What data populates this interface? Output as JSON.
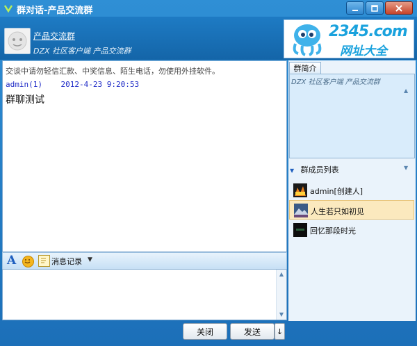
{
  "window": {
    "title": "群对话-产品交流群"
  },
  "header": {
    "group_name": "产品交流群",
    "group_subtitle": "DZX 社区客户端 产品交流群",
    "ad": {
      "top": "2345.com",
      "bottom": "网址大全"
    }
  },
  "chat": {
    "notice": "交谈中请勿轻信汇款、中奖信息、陌生电话，勿使用外挂软件。",
    "messages": [
      {
        "sender": "admin(1)",
        "time": "2012-4-23 9:20:53",
        "text": "群聊测试"
      }
    ]
  },
  "toolbar": {
    "history_label": "消息记录"
  },
  "input": {
    "value": "",
    "placeholder": ""
  },
  "buttons": {
    "close_label": "关闭",
    "send_label": "发送"
  },
  "sidebar": {
    "intro_tab": "群简介",
    "intro_text": "DZX 社区客户端 产品交流群",
    "members_header": "群成员列表",
    "members": [
      {
        "name": "admin[创建人]",
        "icon": "avatar-admin-icon"
      },
      {
        "name": "人生若只如初见",
        "icon": "avatar-mountain-icon",
        "selected": true
      },
      {
        "name": "回忆那段时光",
        "icon": "avatar-dark-icon"
      }
    ]
  },
  "colors": {
    "titlebar": "#1c6fb8",
    "accent": "#1aa2dd",
    "selected": "#fbe9be",
    "panel": "#eaf3fb"
  }
}
